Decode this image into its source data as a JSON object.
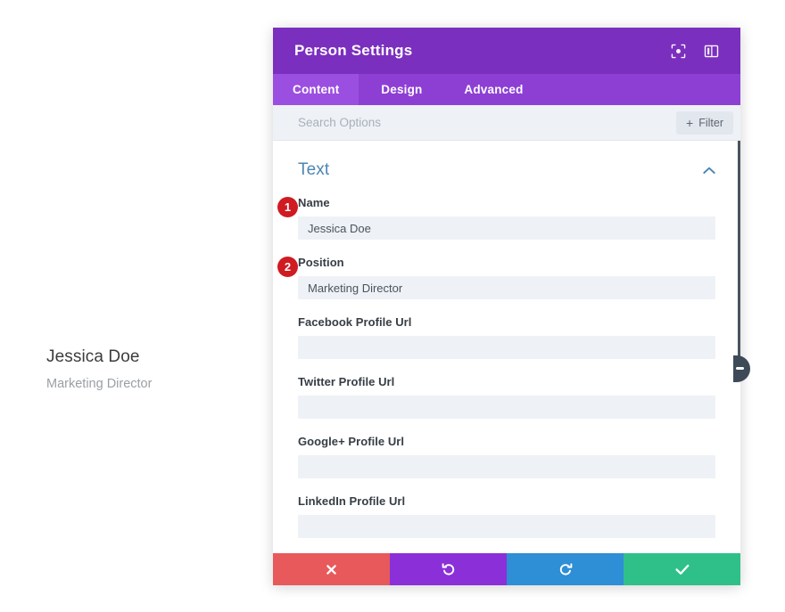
{
  "preview": {
    "name": "Jessica Doe",
    "position": "Marketing Director"
  },
  "modal": {
    "title": "Person Settings",
    "header_icons": [
      {
        "name": "focus-target-icon",
        "label": "Focus"
      },
      {
        "name": "layout-panel-icon",
        "label": "Panel Layout"
      }
    ],
    "tabs": [
      {
        "label": "Content",
        "active": true
      },
      {
        "label": "Design",
        "active": false
      },
      {
        "label": "Advanced",
        "active": false
      }
    ],
    "search": {
      "placeholder": "Search Options",
      "value": ""
    },
    "filter": {
      "label": "Filter",
      "plus": "+"
    },
    "section": {
      "title": "Text",
      "collapse_state": "expanded"
    },
    "fields": [
      {
        "label": "Name",
        "value": "Jessica Doe",
        "placeholder": "",
        "badge": "1"
      },
      {
        "label": "Position",
        "value": "Marketing Director",
        "placeholder": "",
        "badge": "2"
      },
      {
        "label": "Facebook Profile Url",
        "value": "",
        "placeholder": "",
        "badge": ""
      },
      {
        "label": "Twitter Profile Url",
        "value": "",
        "placeholder": "",
        "badge": ""
      },
      {
        "label": "Google+ Profile Url",
        "value": "",
        "placeholder": "",
        "badge": ""
      },
      {
        "label": "LinkedIn Profile Url",
        "value": "",
        "placeholder": "",
        "badge": ""
      }
    ],
    "footer": [
      {
        "name": "cancel-button",
        "icon": "close-x-icon",
        "color": "#e8595c"
      },
      {
        "name": "undo-button",
        "icon": "undo-arrow-icon",
        "color": "#8b30d8"
      },
      {
        "name": "redo-button",
        "icon": "redo-arrow-icon",
        "color": "#2e8ed6"
      },
      {
        "name": "save-button",
        "icon": "checkmark-icon",
        "color": "#2fc08a"
      }
    ]
  },
  "colors": {
    "header_purple": "#7b2fbe",
    "tabbar_purple": "#8d3fd4",
    "active_tab_purple": "#9b4fe0",
    "section_title_blue": "#4c86b4",
    "badge_red": "#cf1b21",
    "input_bg": "#eef1f6",
    "scrollbar": "#4a5461"
  }
}
